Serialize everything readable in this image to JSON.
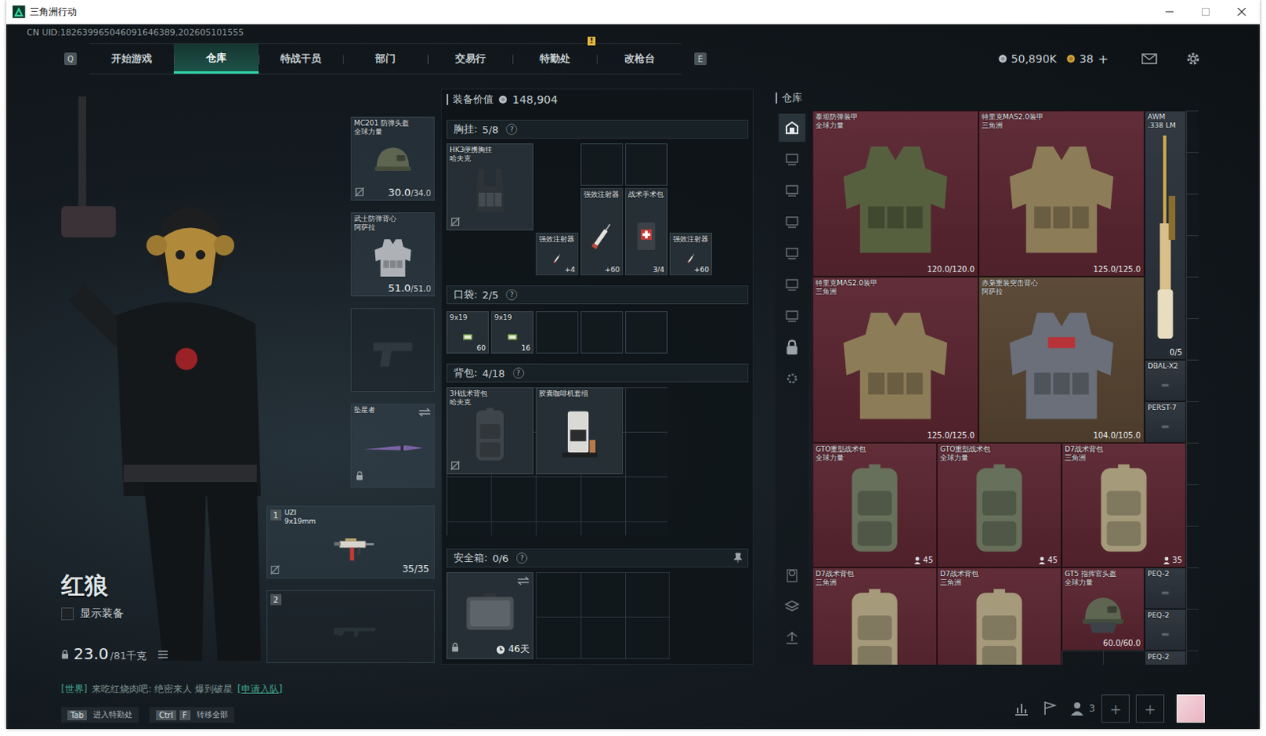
{
  "window": {
    "title": "三角洲行动"
  },
  "uid": "CN UID:182639965046091646389,202605101555",
  "nav": {
    "left_key": "Q",
    "right_key": "E",
    "tabs": [
      {
        "label": "开始游戏",
        "selected": false
      },
      {
        "label": "仓库",
        "selected": true
      },
      {
        "label": "特战干员",
        "selected": false
      },
      {
        "label": "部门",
        "selected": false
      },
      {
        "label": "交易行",
        "selected": false
      },
      {
        "label": "特勤处",
        "selected": false,
        "badge": "!"
      },
      {
        "label": "改枪台",
        "selected": false
      }
    ],
    "currencies": [
      {
        "value": "50,890K",
        "color": "#b9c3c8"
      },
      {
        "value": "38",
        "color": "#d4a53a"
      }
    ],
    "add": "+"
  },
  "character": {
    "name": "红狼",
    "show_equipment": {
      "label": "显示装备",
      "checked": false
    },
    "weight": {
      "value": "23.0",
      "max": "/81千克"
    }
  },
  "equipment": {
    "helmet": {
      "name": "MC201 防弹头盔",
      "sub": "全球力量",
      "reading": "30.0",
      "max": "/34.0",
      "kind": "helmet",
      "marked": true
    },
    "armor": {
      "name": "武士防弹背心",
      "sub": "阿萨拉",
      "reading": "51.0",
      "max": "/51.0",
      "kind": "vest-grey",
      "marked": false
    },
    "pistol": {
      "kind": "pistol",
      "empty": true
    },
    "melee": {
      "name": "坠星者",
      "kind": "knife",
      "locked": true,
      "swappable": true
    },
    "weapons": [
      {
        "index": "1",
        "name": "UZI",
        "caliber": "9x19mm",
        "reading": "35/35",
        "kind": "smg",
        "marked": true,
        "empty": false
      },
      {
        "index": "2",
        "kind": "rifle-ghost",
        "empty": true
      }
    ]
  },
  "loadout": {
    "value_label": "装备价值",
    "value": "148,904",
    "chest": {
      "title": "胸挂",
      "count": "5/8",
      "help": "?",
      "items": [
        {
          "name": "HK3便携胸挂",
          "sub": "哈夫克",
          "kind": "rig",
          "marked": true
        },
        {
          "name": "强效注射器",
          "count": "+4",
          "kind": "syringe",
          "marked": false
        },
        {
          "name": "强效注射器",
          "count": "+60",
          "kind": "syringe",
          "marked": false
        },
        {
          "name": "战术手术包",
          "count": "3/4",
          "kind": "medkit",
          "marked": false
        },
        {
          "name": "强效注射器",
          "count": "+60",
          "kind": "syringe",
          "marked": false
        }
      ]
    },
    "pockets": {
      "title": "口袋",
      "count": "2/5",
      "help": "?",
      "items": [
        {
          "name": "9x19",
          "count": "60",
          "kind": "ammo",
          "marked": false
        },
        {
          "name": "9x19",
          "count": "16",
          "kind": "ammo",
          "marked": false
        }
      ]
    },
    "backpack": {
      "title": "背包",
      "count": "4/18",
      "help": "?",
      "items": [
        {
          "name": "3H战术背包",
          "sub": "哈夫克",
          "kind": "pack-3h",
          "marked": true
        },
        {
          "name": "胶囊咖啡机套组",
          "kind": "coffee",
          "marked": false
        }
      ]
    },
    "safe": {
      "title": "安全箱",
      "count": "0/6",
      "help": "?",
      "item": {
        "kind": "case",
        "timer": "46天",
        "locked": true,
        "swappable": true
      }
    }
  },
  "warehouse": {
    "title": "仓库",
    "tabs": [
      {
        "selected": true
      },
      {
        "selected": false
      },
      {
        "selected": false
      },
      {
        "selected": false
      },
      {
        "selected": false
      },
      {
        "selected": false
      },
      {
        "selected": false
      }
    ],
    "items": [
      {
        "name": "泰坦防弹装甲",
        "sub": "全球力量",
        "reading": "120.0/120.0",
        "kind": "vest",
        "color": "#5a2530"
      },
      {
        "name": "特里克MAS2.0装甲",
        "sub": "三角洲",
        "reading": "125.0/125.0",
        "kind": "vest-camo",
        "color": "#5a2530"
      },
      {
        "name": "AWM",
        "sub": ".338 LM",
        "reading": "0/5",
        "kind": "rifle",
        "color": "#2a3139"
      },
      {
        "name": "特里克MAS2.0装甲",
        "sub": "三角洲",
        "reading": "125.0/125.0",
        "kind": "vest-camo",
        "color": "#5a2530"
      },
      {
        "name": "赤枭重装突击背心",
        "sub": "阿萨拉",
        "reading": "104.0/105.0",
        "kind": "vest-heavy",
        "color": "#574431"
      },
      {
        "name": "DBAL-X2",
        "kind": "attach",
        "color": "#2a3139"
      },
      {
        "name": "PERST-7",
        "kind": "attach",
        "color": "#2a3139"
      },
      {
        "name": "GTO重型战术包",
        "sub": "全球力量",
        "reading": "45",
        "kind": "pack-gto",
        "color": "#5a2530"
      },
      {
        "name": "GTO重型战术包",
        "sub": "全球力量",
        "reading": "45",
        "kind": "pack-gto",
        "color": "#5a2530"
      },
      {
        "name": "D7战术背包",
        "sub": "三角洲",
        "reading": "35",
        "kind": "pack-d7",
        "color": "#5a2530"
      },
      {
        "name": "D7战术背包",
        "sub": "三角洲",
        "kind": "pack-d7",
        "color": "#5a2530"
      },
      {
        "name": "D7战术背包",
        "sub": "三角洲",
        "kind": "pack-d7",
        "color": "#5a2530"
      },
      {
        "name": "GT5 指挥官头盔",
        "sub": "全球力量",
        "reading": "60.0/60.0",
        "kind": "helmet2",
        "color": "#5a2530"
      },
      {
        "name": "PEQ-2",
        "kind": "attach",
        "color": "#2a3139"
      },
      {
        "name": "PEQ-2",
        "kind": "attach",
        "color": "#2a3139"
      },
      {
        "name": "PEQ-2",
        "kind": "attach",
        "color": "#2a3139"
      }
    ]
  },
  "footer": {
    "chat": {
      "channel": "[世界]",
      "text": "来吃红烧肉吧: 绝密来人 爆到破星",
      "action": "[申请入队]"
    },
    "hints": [
      {
        "keys": [
          "Tab"
        ],
        "label": "进入特勤处"
      },
      {
        "keys": [
          "Ctrl",
          "F"
        ],
        "label": "转移全部"
      }
    ],
    "friends": "3",
    "slots": [
      "+",
      "+"
    ]
  }
}
